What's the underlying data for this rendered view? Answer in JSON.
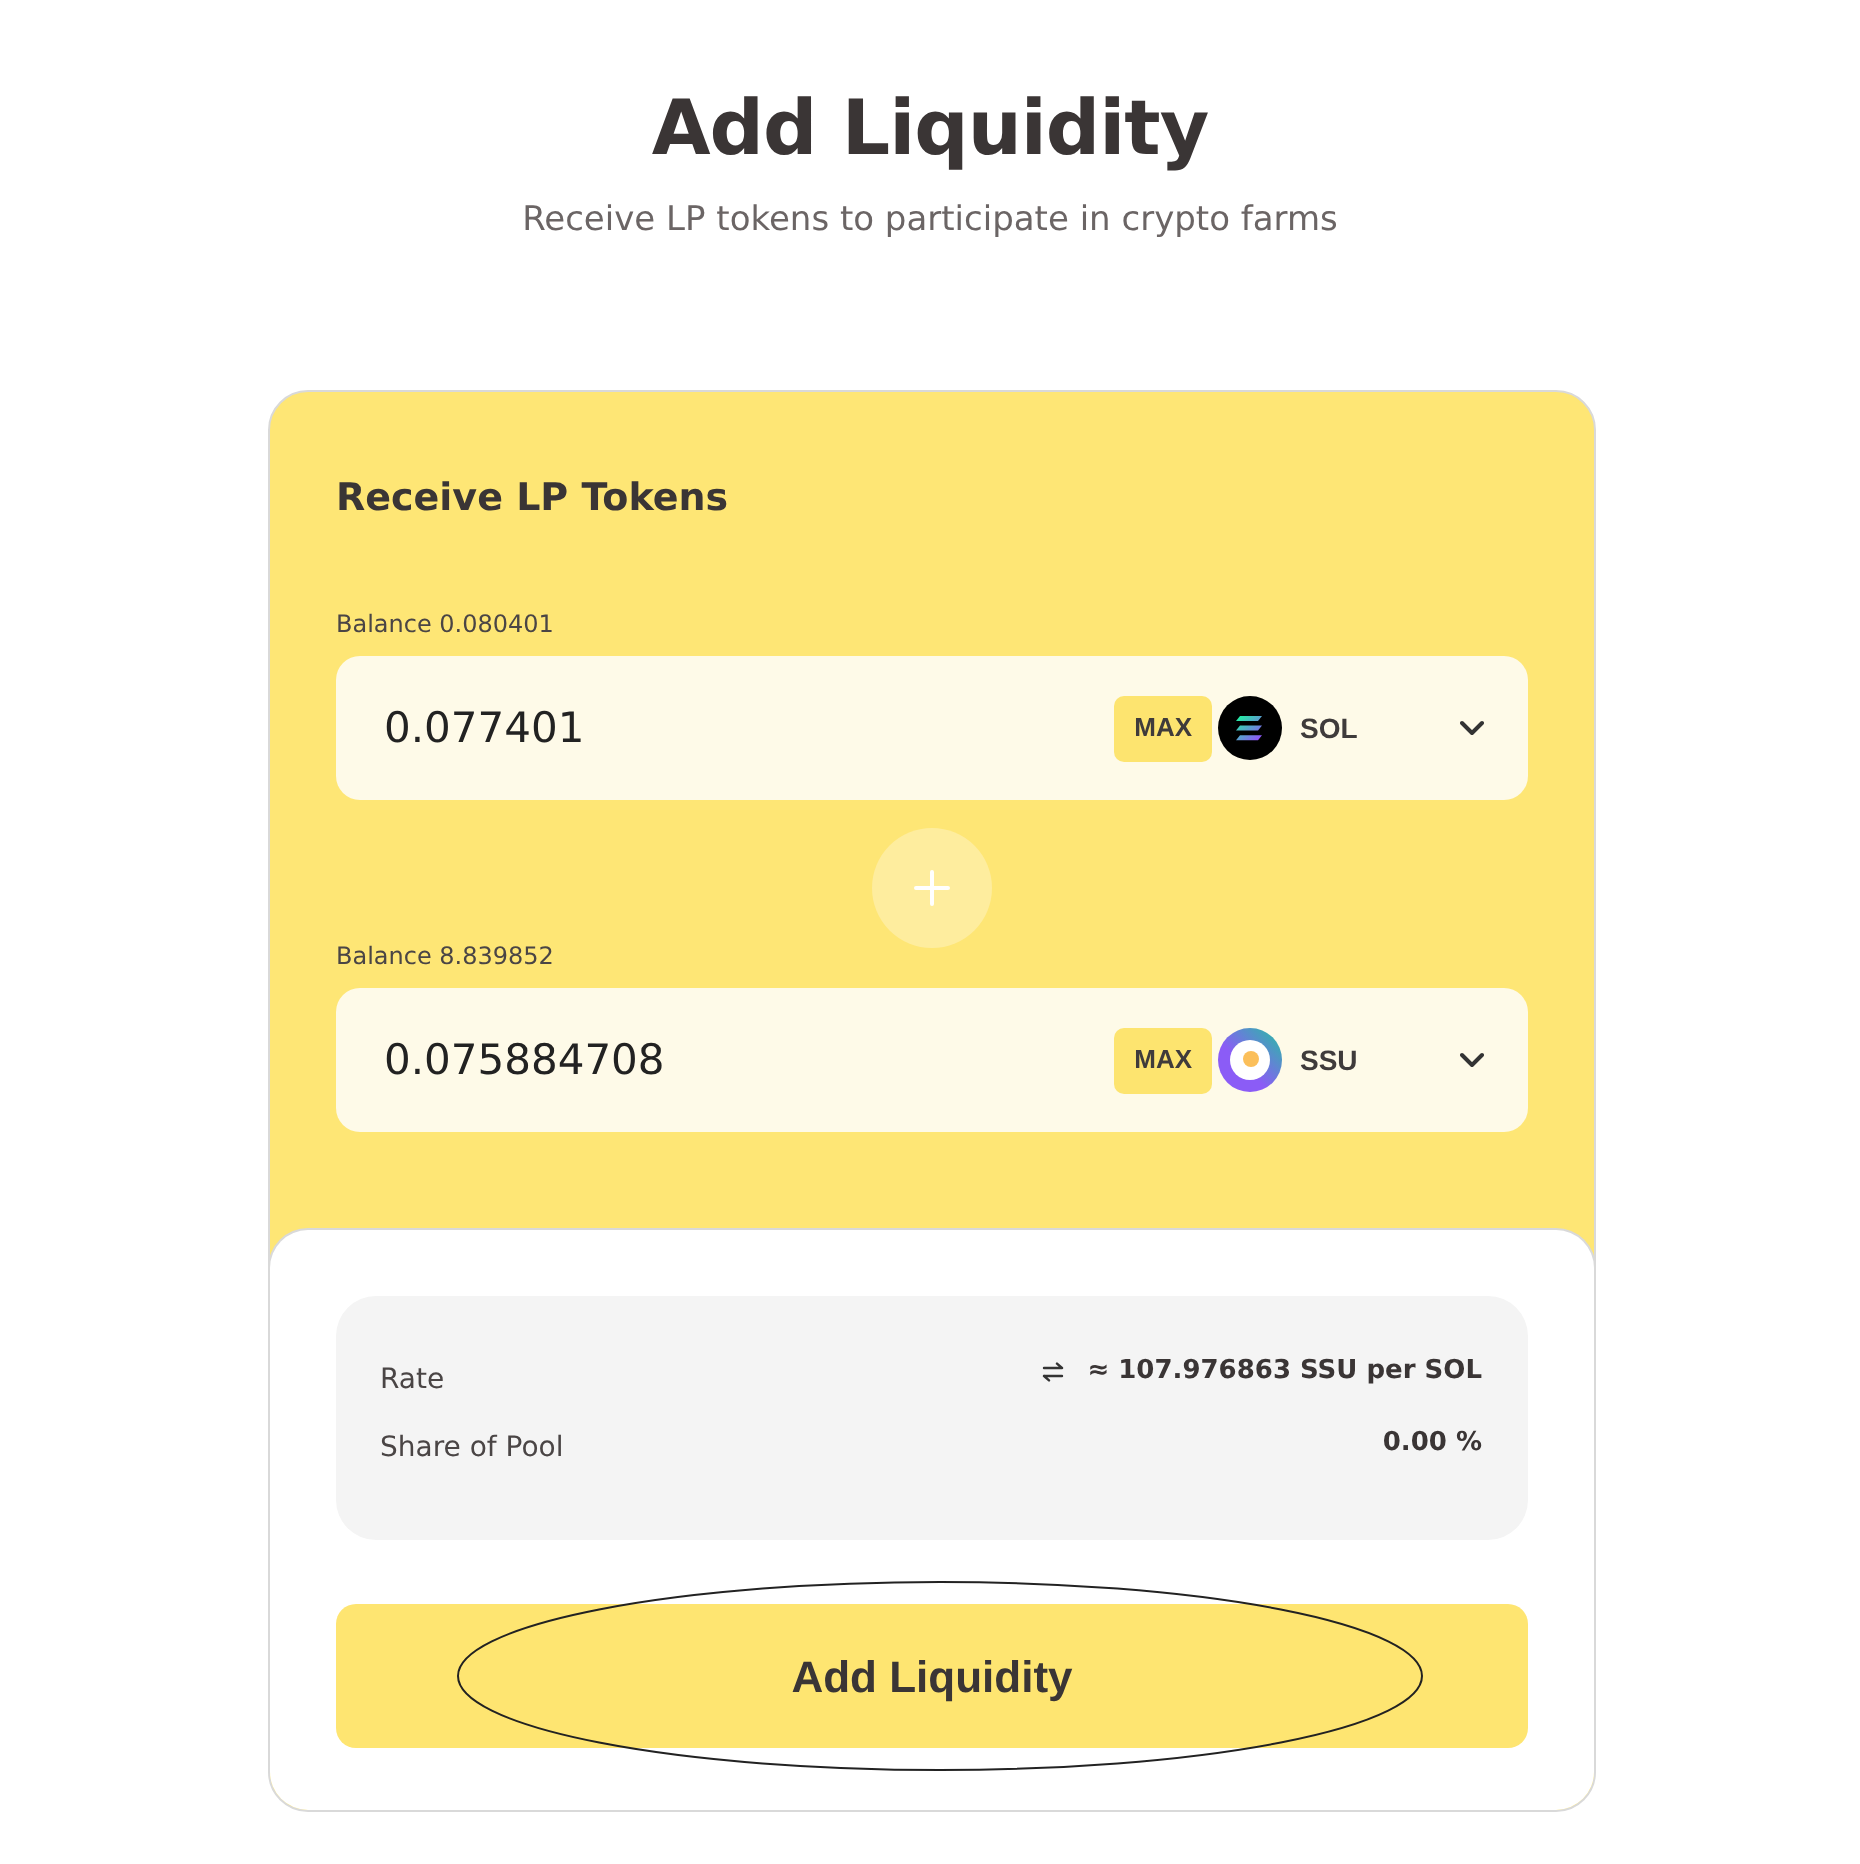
{
  "header": {
    "title": "Add Liquidity",
    "subtitle": "Receive LP tokens to participate in crypto farms"
  },
  "form": {
    "title": "Receive LP Tokens",
    "inputs": [
      {
        "balance": "Balance 0.080401",
        "value": "0.077401",
        "max_label": "MAX",
        "token": "SOL",
        "kind": "sol"
      },
      {
        "balance": "Balance 8.839852",
        "value": "0.075884708",
        "max_label": "MAX",
        "token": "SSU",
        "kind": "ssu"
      }
    ]
  },
  "summary": {
    "rows": [
      {
        "label": "Rate",
        "value": "≈ 107.976863 SSU per SOL",
        "kind": "rate"
      },
      {
        "label": "Share of Pool",
        "value": "0.00 %",
        "kind": "plain"
      }
    ]
  },
  "submit": {
    "label": "Add Liquidity",
    "circled": true
  }
}
